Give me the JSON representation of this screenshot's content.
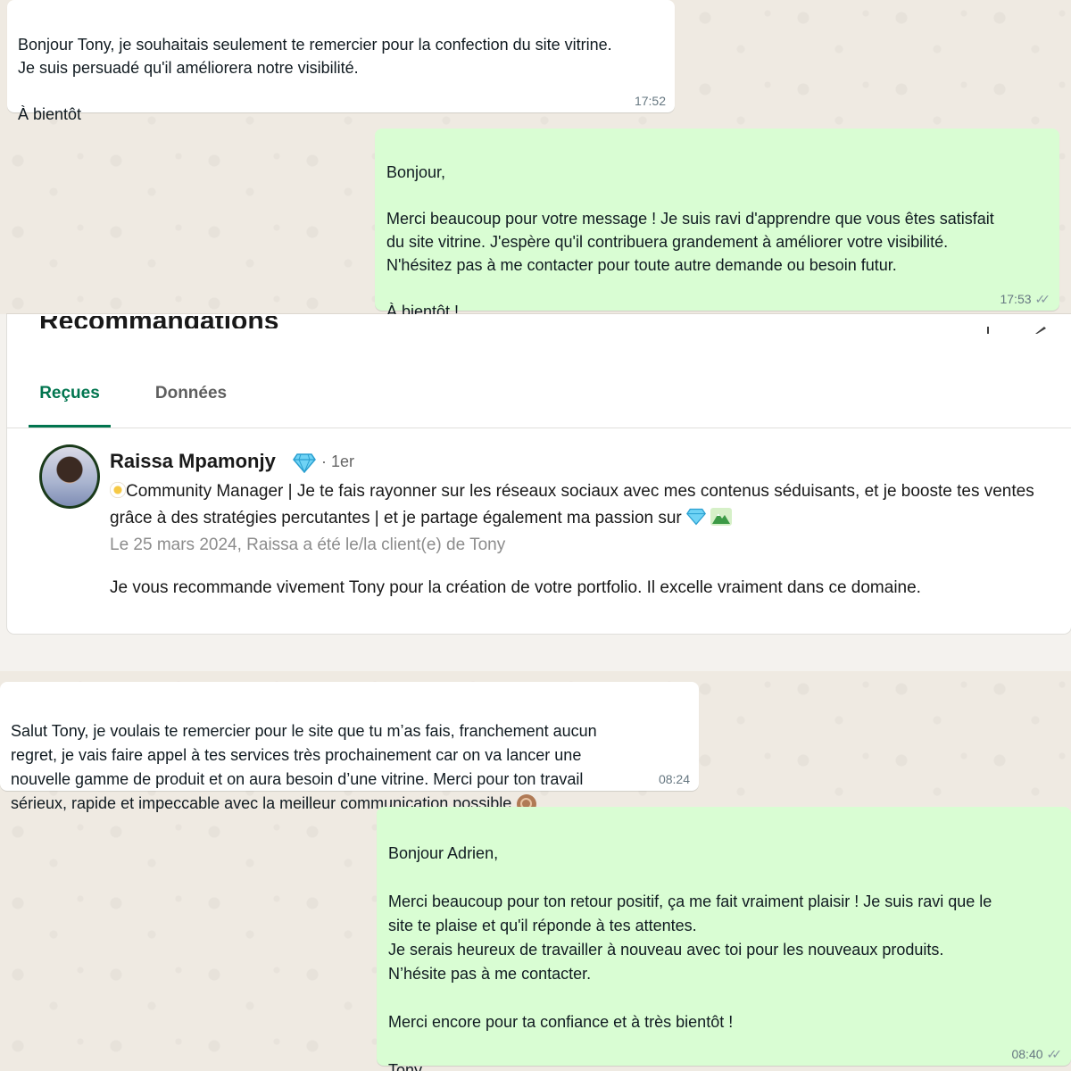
{
  "chat_top": {
    "messages": [
      {
        "direction": "incoming",
        "text": "Bonjour Tony, je souhaitais seulement te remercier pour la confection du site vitrine.\nJe suis persuadé qu'il améliorera notre visibilité.\n\nÀ  bientôt",
        "time": "17:52"
      },
      {
        "direction": "outgoing",
        "text": "Bonjour,\n\nMerci beaucoup pour votre message ! Je suis ravi d'apprendre que vous êtes satisfait\ndu site vitrine. J'espère qu'il contribuera grandement à améliorer votre visibilité.\nN'hésitez pas à me contacter pour toute autre demande ou besoin futur.\n\nÀ bientôt !",
        "time": "17:53",
        "status": "read"
      }
    ]
  },
  "recommendations": {
    "section_title": "Recommandations",
    "tabs": [
      {
        "label": "Reçues",
        "active": true
      },
      {
        "label": "Données",
        "active": false
      }
    ],
    "item": {
      "name": "Raissa Mpamonjy",
      "badge_icon": "diamond-icon",
      "degree": "· 1er",
      "headline": "Community Manager | Je te fais rayonner sur les réseaux sociaux avec mes contenus séduisants, et je booste tes ventes grâce à des stratégies percutantes | et je partage également ma passion sur",
      "context": "Le 25 mars 2024, Raissa a été le/la client(e) de Tony",
      "text": "Je vous recommande vivement Tony pour la création de votre portfolio. Il excelle vraiment dans ce domaine."
    }
  },
  "chat_bottom": {
    "messages": [
      {
        "direction": "incoming",
        "text": "Salut Tony, je voulais te remercier pour le site que tu m’as fais, franchement aucun\nregret, je vais faire appel à tes services très prochainement car on va lancer une\nnouvelle gamme de produit et on aura besoin d’une vitrine. Merci pour ton travail\nsérieux, rapide et impeccable avec la meilleur communication possible",
        "time": "08:24"
      },
      {
        "direction": "outgoing",
        "text": "Bonjour Adrien,\n\nMerci beaucoup pour ton retour positif, ça me fait vraiment plaisir ! Je suis ravi que le\nsite te plaise et qu'il réponde à tes attentes.\nJe serais heureux de travailler à nouveau avec toi pour les nouveaux produits.\nN’hésite pas à me contacter.\n\nMerci encore pour ta confiance et à très bientôt !\n\nTony",
        "time": "08:40",
        "status": "read"
      }
    ]
  },
  "colors": {
    "chat_background": "#efeae2",
    "incoming_bubble": "#ffffff",
    "outgoing_bubble": "#d9fdd3",
    "linkedin_green": "#01754f"
  }
}
